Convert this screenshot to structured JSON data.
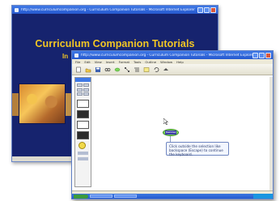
{
  "back_window": {
    "title": "http://www.curriculumcompanion.org - Curriculum Companion Tutorials - Microsoft Internet Explorer",
    "heading": "Curriculum Companion Tutorials",
    "subheading": "In"
  },
  "front_window": {
    "title": "http://www.curriculumcompanion.org - Curriculum Companion Tutorials - Microsoft Internet Explorer",
    "menu": [
      "File",
      "Edit",
      "View",
      "Insert",
      "Format",
      "Tools",
      "Outline",
      "Window",
      "Help"
    ],
    "toolbar_icons": [
      "new-icon",
      "open-icon",
      "save-icon",
      "link-icon",
      "add-symbol-icon",
      "arrange-icon",
      "outline-icon",
      "note-icon",
      "undo-icon",
      "arrow-icon"
    ],
    "node_label": "MainIdea",
    "callout_text": "Click outside the selection like backspace (Escape) to continue the keyboard."
  },
  "colors": {
    "titlebar": "#2659cf",
    "back_bg": "#16236e",
    "heading": "#f2c623",
    "node": "#7ed85a"
  }
}
